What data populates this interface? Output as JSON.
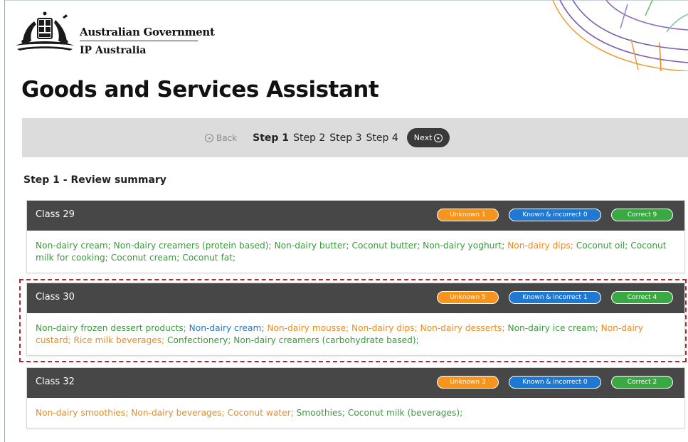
{
  "header": {
    "gov_name": "Australian Government",
    "agency": "IP Australia"
  },
  "page_title": "Goods and Services Assistant",
  "nav": {
    "back_label": "Back",
    "steps": [
      "Step 1",
      "Step 2",
      "Step 3",
      "Step 4"
    ],
    "active_step": "Step 1",
    "next_label": "Next"
  },
  "section_title": "Step 1 - Review summary",
  "colors": {
    "unknown": "#f7941d",
    "known_incorrect": "#1f78d1",
    "correct": "#3aa843",
    "card_header": "#474747"
  },
  "classes": [
    {
      "title": "Class 29",
      "unknown_label": "Unknown 1",
      "known_label": "Known & incorrect 0",
      "correct_label": "Correct 9",
      "terms": [
        {
          "text": "Non-dairy cream;",
          "status": "correct"
        },
        {
          "text": "Non-dairy creamers (protein based);",
          "status": "correct"
        },
        {
          "text": "Non-dairy butter;",
          "status": "correct"
        },
        {
          "text": "Coconut butter;",
          "status": "correct"
        },
        {
          "text": "Non-dairy yoghurt;",
          "status": "correct"
        },
        {
          "text": "Non-dairy dips;",
          "status": "unknown"
        },
        {
          "text": "Coconut oil;",
          "status": "correct"
        },
        {
          "text": "Coconut milk for cooking;",
          "status": "correct"
        },
        {
          "text": "Coconut cream;",
          "status": "correct"
        },
        {
          "text": "Coconut fat;",
          "status": "correct"
        }
      ]
    },
    {
      "title": "Class 30",
      "unknown_label": "Unknown 5",
      "known_label": "Known & incorrect 1",
      "correct_label": "Correct 4",
      "terms": [
        {
          "text": "Non-dairy frozen dessert products;",
          "status": "correct"
        },
        {
          "text": "Non-dairy cream;",
          "status": "known"
        },
        {
          "text": "Non-dairy mousse;",
          "status": "unknown"
        },
        {
          "text": "Non-dairy dips;",
          "status": "unknown"
        },
        {
          "text": "Non-dairy desserts;",
          "status": "unknown"
        },
        {
          "text": "Non-dairy ice cream;",
          "status": "correct"
        },
        {
          "text": "Non-dairy custard;",
          "status": "unknown"
        },
        {
          "text": "Rice milk beverages;",
          "status": "unknown"
        },
        {
          "text": "Confectionery;",
          "status": "correct"
        },
        {
          "text": "Non-dairy creamers (carbohydrate based);",
          "status": "correct"
        }
      ]
    },
    {
      "title": "Class 32",
      "unknown_label": "Unknown 3",
      "known_label": "Known & incorrect 0",
      "correct_label": "Correct 2",
      "terms": [
        {
          "text": "Non-dairy smoothies;",
          "status": "unknown"
        },
        {
          "text": "Non-dairy beverages;",
          "status": "unknown"
        },
        {
          "text": "Coconut water;",
          "status": "unknown"
        },
        {
          "text": "Smoothies;",
          "status": "correct"
        },
        {
          "text": "Coconut milk (beverages);",
          "status": "correct"
        }
      ]
    }
  ]
}
